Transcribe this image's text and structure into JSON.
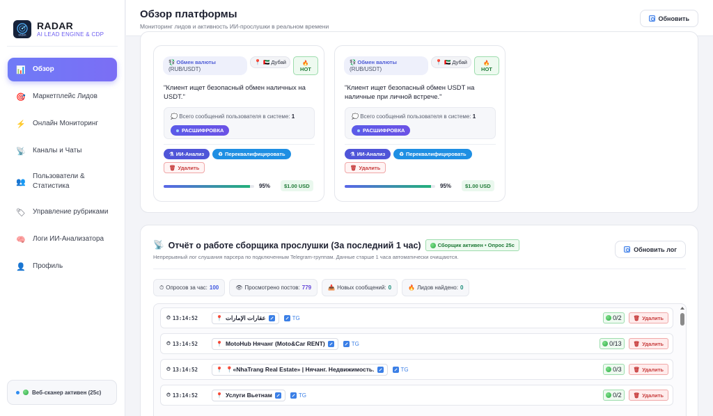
{
  "brand": {
    "title": "RADAR",
    "subtitle": "AI LEAD ENGINE & CDP",
    "logo_text": "RADAR"
  },
  "sidebar": {
    "items": [
      {
        "label": "Обзор",
        "icon": "chart-icon",
        "glyph": "📊",
        "active": true
      },
      {
        "label": "Маркетплейс Лидов",
        "icon": "target-icon",
        "glyph": "🎯"
      },
      {
        "label": "Онлайн Мониторинг",
        "icon": "lightning-icon",
        "glyph": "⚡"
      },
      {
        "label": "Каналы и Чаты",
        "icon": "satellite-icon",
        "glyph": "📡"
      },
      {
        "label": "Пользователи & Статистика",
        "icon": "users-icon",
        "glyph": "👥"
      },
      {
        "label": "Управление рубриками",
        "icon": "tag-icon",
        "glyph": "🏷"
      },
      {
        "label": "Логи ИИ-Анализатора",
        "icon": "brain-icon",
        "glyph": "🧠"
      },
      {
        "label": "Профиль",
        "icon": "user-icon",
        "glyph": "👤"
      }
    ],
    "scanner_status": "Веб-сканер активен (25с)"
  },
  "header": {
    "title": "Обзор платформы",
    "subtitle": "Мониторинг лидов и активность ИИ-прослушки в реальном времени",
    "refresh_label": "Обновить"
  },
  "leads": [
    {
      "category": "💱 Обмен валюты",
      "category_sub": "(RUB/USDT)",
      "city": "🇦🇪 Дубай",
      "hot": "HOT",
      "quote": "\"Клиент ищет безопасный обмен наличных на USDT.\"",
      "msg_label": "Всего сообщений пользователя в системе:",
      "msg_count": "1",
      "decode_label": "РАСШИФРОВКА",
      "ai_label": "ИИ-Анализ",
      "requalify_label": "Переквалифицировать",
      "delete_label": "Удалить",
      "confidence": 95,
      "confidence_text": "95%",
      "price": "$1.00 USD"
    },
    {
      "category": "💱 Обмен валюты",
      "category_sub": "(RUB/USDT)",
      "city": "🇦🇪 Дубай",
      "hot": "HOT",
      "quote": "\"Клиент ищет безопасный обмен USDT на наличные при личной встрече.\"",
      "msg_label": "Всего сообщений пользователя в системе:",
      "msg_count": "1",
      "decode_label": "РАСШИФРОВКА",
      "ai_label": "ИИ-Анализ",
      "requalify_label": "Переквалифицировать",
      "delete_label": "Удалить",
      "confidence": 95,
      "confidence_text": "95%",
      "price": "$1.00 USD"
    }
  ],
  "log": {
    "title": "Отчёт о работе сборщика прослушки (За последний 1 час)",
    "badge": "Сборщик активен • Опрос 25с",
    "subtitle": "Непрерывный лог слушания парсера по подключенным Telegram-группам. Данные старше 1 часа автоматически очищаются.",
    "refresh_label": "Обновить лог",
    "stats": {
      "polls_label": "Опросов за час:",
      "polls": "100",
      "posts_label": "Просмотрено постов:",
      "posts": "779",
      "new_label": "Новых сообщений:",
      "new": "0",
      "leads_label": "Лидов найдено:",
      "leads": "0"
    },
    "rows": [
      {
        "time": "13:14:52",
        "channel": "عقارات الإمارات",
        "source": "TG",
        "count": "0/2",
        "delete": "Удалить"
      },
      {
        "time": "13:14:52",
        "channel": "MotoHub Нячанг (Moto&Car RENT)",
        "source": "TG",
        "count": "0/13",
        "delete": "Удалить"
      },
      {
        "time": "13:14:52",
        "channel": "📍«NhaTrang Real Estate» | Нячанг. Недвижимость.",
        "source": "TG",
        "count": "0/3",
        "delete": "Удалить"
      },
      {
        "time": "13:14:52",
        "channel": "Услуги Вьетнам",
        "source": "TG",
        "count": "0/2",
        "delete": "Удалить"
      }
    ]
  },
  "colors": {
    "accent": "#6f7bf7",
    "green": "#1f7a37",
    "danger": "#c73b3b",
    "link": "#3b7fe6"
  }
}
